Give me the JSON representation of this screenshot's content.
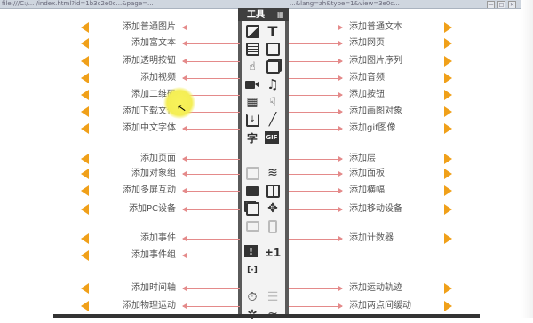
{
  "browser": {
    "url_left": "file:///C:/... /index.html?id=1b3c2e0c...&page=...",
    "url_right": "...&lang=zh&type=1&view=3e0c...",
    "window_buttons": [
      "—",
      "□",
      "✕"
    ]
  },
  "panel": {
    "title": "工具",
    "grid_icon": "grid-icon"
  },
  "left_labels": [
    "添加普通图片",
    "添加富文本",
    "添加透明按钮",
    "添加视频",
    "添加二维码",
    "添加下载文件",
    "添加中文字体",
    "添加页面",
    "添加对象组",
    "添加多屏互动",
    "添加PC设备",
    "添加事件",
    "添加事件组",
    "添加时间轴",
    "添加物理运动"
  ],
  "right_labels": [
    "添加普通文本",
    "添加网页",
    "添加图片序列",
    "添加音频",
    "添加按钮",
    "添加画图对象",
    "添加gif图像",
    "添加层",
    "添加面板",
    "添加横幅",
    "添加移动设备",
    "添加计数器",
    "添加运动轨迹",
    "添加两点间缓动"
  ],
  "tools_left": [
    "image-icon",
    "richtext-icon",
    "touch-icon",
    "video-icon",
    "qrcode-icon",
    "download-icon",
    "chinese-font-icon",
    "page-icon",
    "folder-icon",
    "multiscreen-icon",
    "pc-device-icon",
    "event-icon",
    "event-group-icon",
    "timer-icon",
    "physics-icon"
  ],
  "tools_right": [
    "text-icon",
    "webpage-icon",
    "image-sequence-icon",
    "audio-icon",
    "button-icon",
    "brush-icon",
    "gif-icon",
    "layers-icon",
    "panel-icon",
    "banner-icon",
    "mobile-device-icon",
    "counter-icon",
    "motion-path-icon",
    "tween-icon"
  ],
  "glyphs": {
    "text": "T",
    "font": "字",
    "gif": "GIF",
    "counter": "±1",
    "event": "!",
    "event_group": "[·]",
    "timer": "⏱",
    "audio": "♫",
    "brush": "╱",
    "cursor": "↖"
  },
  "colors": {
    "accent_triangle": "#f0a019",
    "arrow": "#e48a8a",
    "panel_bg": "#5a5a5a",
    "panel_header": "#3f3f3f",
    "highlight": "#f4ee55"
  }
}
